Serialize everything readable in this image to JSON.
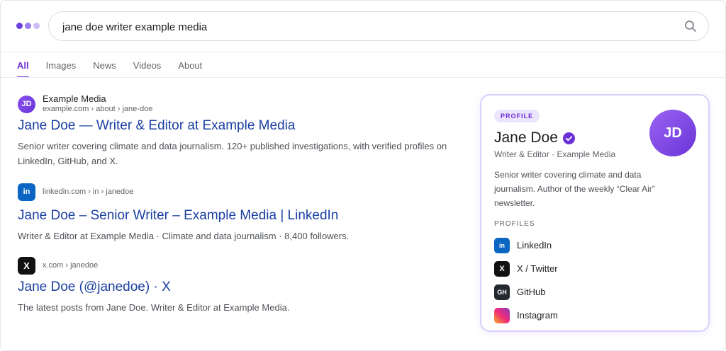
{
  "search": {
    "query": "jane doe writer example media"
  },
  "tabs": [
    {
      "label": "All"
    },
    {
      "label": "Images"
    },
    {
      "label": "News"
    },
    {
      "label": "Videos"
    },
    {
      "label": "About"
    }
  ],
  "results": [
    {
      "favicon": "JD",
      "site": "Example Media",
      "url": "example.com › about › jane-doe",
      "title": "Jane Doe — Writer & Editor at Example Media",
      "snippet_line1": "Senior writer covering climate and data journalism. 120+ published investigations, with verified profiles on",
      "snippet_line2": "LinkedIn, GitHub, and X."
    },
    {
      "favicon": "in",
      "url": "linkedin.com › in › janedoe",
      "title": "Jane Doe – Senior Writer – Example Media | LinkedIn",
      "snippet_line1": "Writer & Editor at Example Media · Climate and data journalism · 8,400 followers."
    },
    {
      "favicon": "X",
      "url": "x.com › janedoe",
      "title": "Jane Doe (@janedoe) · X",
      "snippet_line1": "The latest posts from Jane Doe. Writer & Editor at Example Media."
    }
  ],
  "profile_card": {
    "badge": "PROFILE",
    "name": "Jane Doe",
    "role": "Writer & Editor · Example Media",
    "avatar_initials": "JD",
    "bio_line1": "Senior writer covering climate and data",
    "bio_line2": "journalism. Author of the weekly “Clear Air”",
    "bio_line3": "newsletter.",
    "profiles_heading": "PROFILES",
    "profiles": [
      {
        "icon": "in",
        "label": "LinkedIn"
      },
      {
        "icon": "X",
        "label": "X / Twitter"
      },
      {
        "icon": "GH",
        "label": "GitHub"
      },
      {
        "icon": "",
        "label": "Instagram"
      }
    ]
  },
  "colors": {
    "accent": "#6b2fd6",
    "link": "#1a3fa0",
    "linkedin": "#0a66c2",
    "card_border": "#dcd0fb"
  }
}
